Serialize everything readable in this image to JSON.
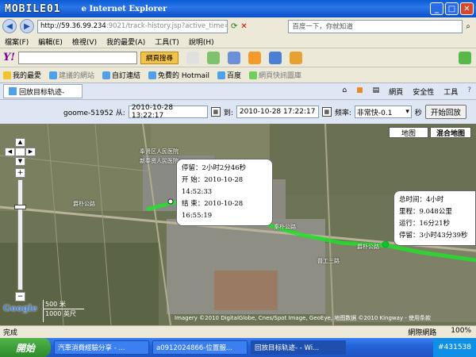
{
  "window": {
    "logo_text": "MOBILE01",
    "title": "e Internet Explorer"
  },
  "address": {
    "url_main": "http://59.36.99.234",
    "url_rest": ":9021/track-history.jsp?active_time=2010-",
    "search_placeholder": "百度一下，你就知道"
  },
  "menu": {
    "items": [
      "檔案(F)",
      "編輯(E)",
      "檢視(V)",
      "我的最愛(A)",
      "工具(T)",
      "說明(H)"
    ]
  },
  "yahoo": {
    "logo": "Y!",
    "search_button": "網頁搜尋"
  },
  "favorites": {
    "label": "我的最愛",
    "items": [
      "建議的網站",
      "自訂連結",
      "免費的 Hotmail",
      "百度",
      "網頁快訊圖庫"
    ]
  },
  "tab": {
    "label": "回放目标轨迹-",
    "tools": [
      "網頁",
      "安全性",
      "工具"
    ]
  },
  "controls": {
    "device": "goome-51952 从:",
    "start_time": "2010-10-28 13:22:17",
    "to_label": "到:",
    "end_time": "2010-10-28 17:22:17",
    "freq_label": "频率:",
    "freq_value": "非常快-0.1",
    "sec_label": "秒",
    "play_button": "开始回放"
  },
  "map": {
    "type_map": "地图",
    "type_hybrid": "混合地图",
    "scale_m": "500 米",
    "scale_ft": "1000 英尺",
    "google": "Google",
    "copyright": "Imagery ©2010 DigitalGlobe, Cnes/Spot Image, GeoEye, 地图数据 ©2010 Kingway - 使用条款",
    "road_labels": [
      "爵朴公路",
      "秦朴公路",
      "爵朴公路",
      "普工三路",
      "奉贤区人民医院",
      "新奉贤人民医院"
    ],
    "stop_box": {
      "line1": "停留：2小时2分46秒",
      "line2": "开 始：2010-10-28 14:52:33",
      "line3": "结 束：2010-10-28 16:55:19"
    },
    "summary_box": {
      "line1": "总时间：4小时",
      "line2": "里程：9.048公里",
      "line3": "运行：16分21秒",
      "line4": "停留：3小时43分39秒"
    }
  },
  "status": {
    "left": "完成",
    "net": "網際網路",
    "zoom": "100%"
  },
  "taskbar": {
    "start": "開始",
    "tasks": [
      "汽車消費經驗分享 - ...",
      "a0912024866-位置服...",
      "回放目标轨迹- - Wi..."
    ],
    "tray": "#431538"
  },
  "colors": {
    "track": "#22e02a",
    "title_blue": "#0a5bd6"
  }
}
